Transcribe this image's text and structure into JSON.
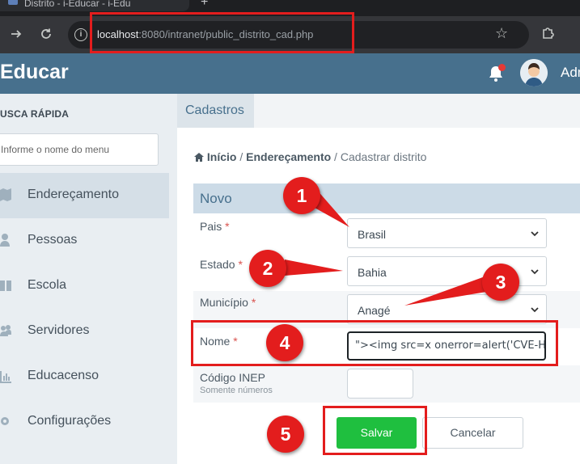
{
  "browser": {
    "tab_title": "Distrito - i-Educar - i-Edu",
    "new_tab_symbol": "+",
    "url_host": "localhost",
    "url_path": ":8080/intranet/public_distrito_cad.php"
  },
  "header": {
    "brand": "Educar",
    "user_name": "Adm"
  },
  "sidebar": {
    "quick_search_label": "USCA RÁPIDA",
    "search_placeholder": "Informe o nome do menu",
    "items": [
      {
        "label": "Endereçamento",
        "icon": "map-icon",
        "active": true
      },
      {
        "label": "Pessoas",
        "icon": "person-icon",
        "active": false
      },
      {
        "label": "Escola",
        "icon": "book-icon",
        "active": false
      },
      {
        "label": "Servidores",
        "icon": "users-icon",
        "active": false
      },
      {
        "label": "Educacenso",
        "icon": "bar-chart-icon",
        "active": false
      },
      {
        "label": "Configurações",
        "icon": "gear-icon",
        "active": false
      }
    ]
  },
  "main": {
    "tab": "Cadastros",
    "breadcrumb": {
      "home": "Início",
      "sep1": " / ",
      "section": "Endereçamento",
      "sep2": " / ",
      "current": "Cadastrar distrito"
    },
    "form": {
      "title": "Novo",
      "required_mark": "*",
      "pais": {
        "label": "Pais",
        "value": "Brasil"
      },
      "estado": {
        "label": "Estado",
        "value": "Bahia"
      },
      "municipio": {
        "label": "Município",
        "value": "Anagé"
      },
      "nome": {
        "label": "Nome",
        "value": "\"><img src=x onerror=alert('CVE-Hu"
      },
      "inep": {
        "label": "Código INEP",
        "hint": "Somente números",
        "value": ""
      },
      "save_label": "Salvar",
      "cancel_label": "Cancelar"
    }
  },
  "annotations": {
    "badges": [
      "1",
      "2",
      "3",
      "4",
      "5"
    ],
    "color": "#e31d1d"
  },
  "colors": {
    "appbar": "#47708d",
    "save_button": "#1fbf3f",
    "sidebar": "#e9eef2"
  }
}
